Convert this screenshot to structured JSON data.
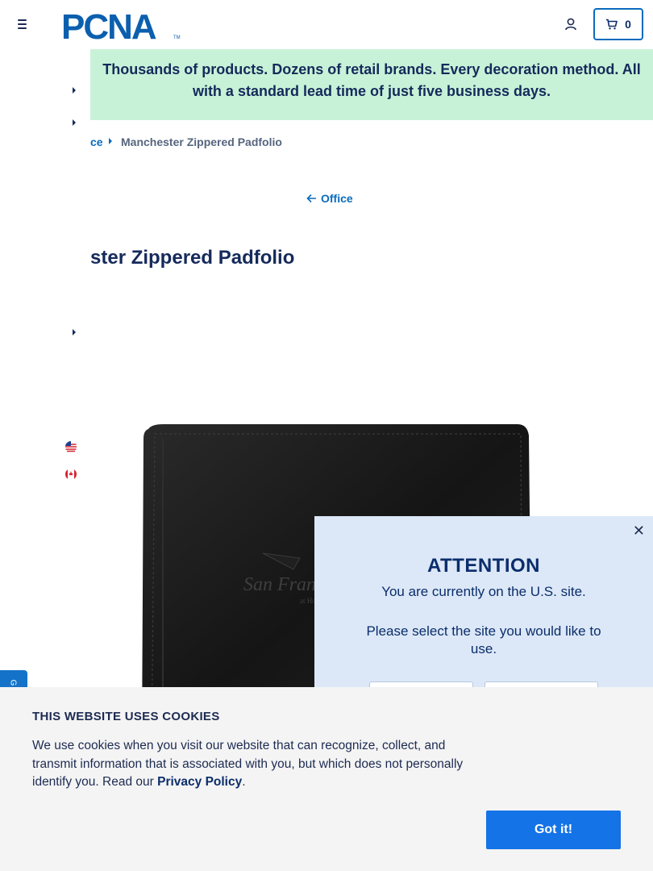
{
  "header": {
    "logo_text": "PCNA",
    "cart_count": "0"
  },
  "promo": {
    "line1": "Thousands of products. Dozens of retail brands. Every decoration method. All",
    "line2": "with a standard lead time of just five business days."
  },
  "breadcrumb": {
    "parent_label": "ce",
    "current_label": "Manchester Zippered Padfolio"
  },
  "back_link": {
    "label": "Office"
  },
  "product": {
    "title_visible": "ster Zippered Padfolio",
    "image_alt": "Manchester Zippered Padfolio"
  },
  "attention": {
    "title": "ATTENTION",
    "line1": "You are currently on the U.S. site.",
    "line2": "Please select the site you would like to use."
  },
  "cookie": {
    "title": "THIS WEBSITE USES COOKIES",
    "text": "We use cookies when you visit our website that can recognize, collect, and transmit information that is associated with you, but which does not personally identify you. Read our",
    "link_label": "Privacy Policy",
    "period": ".",
    "button_label": "Got it!"
  },
  "colors": {
    "brand_navy": "#152a5b",
    "brand_blue": "#0b6bbd",
    "promo_green": "#c8f2d7",
    "button_blue": "#1473e6"
  }
}
